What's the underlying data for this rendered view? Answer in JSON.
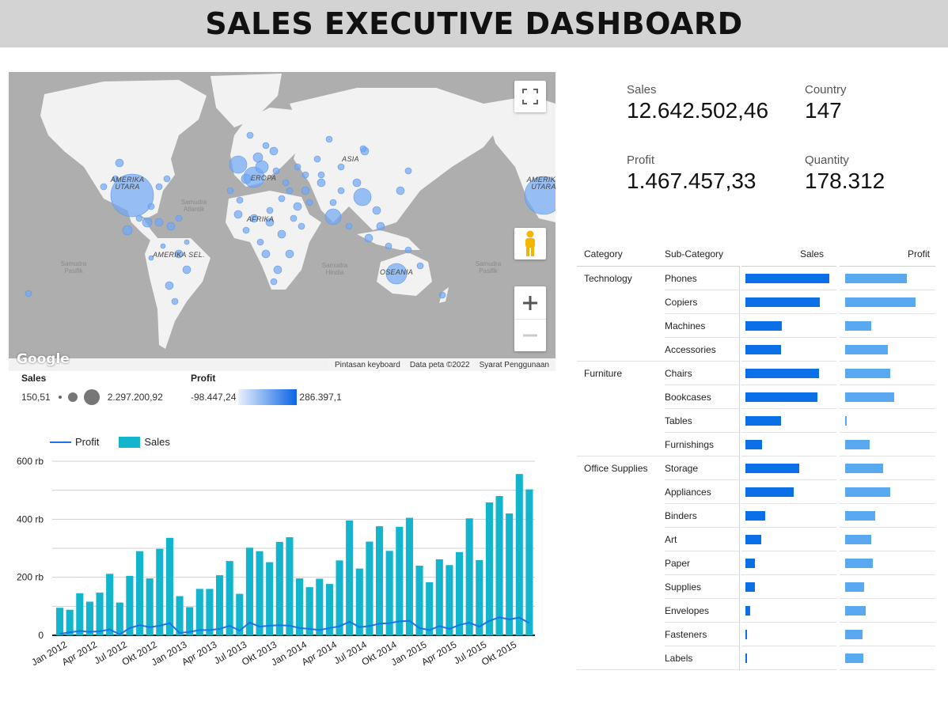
{
  "header": {
    "title": "SALES EXECUTIVE DASHBOARD"
  },
  "map": {
    "labels": {
      "north_america": "AMERIKA UTARA",
      "north_america_repeat": "AMERIKA UTARA",
      "south_america": "AMERIKA SEL.",
      "asia": "ASIA",
      "africa": "AFRIKA",
      "europe": "EROPA",
      "oceania": "OSEANIA"
    },
    "oceans": {
      "atlantic": "Samudra Atlantik",
      "pacific_left": "Samudra Pasifik",
      "indian": "Samudra Hindia",
      "pacific_right": "Samudra Pasifik"
    },
    "google_logo": "Google",
    "footer": {
      "shortcuts": "Pintasan keyboard",
      "map_data": "Data peta ©2022",
      "terms": "Syarat Penggunaan"
    },
    "bubble_color": "#6fa8f5",
    "land_color": "#f2f2f2",
    "water_color": "#aeaeae"
  },
  "legend": {
    "sales": {
      "title": "Sales",
      "min": "150,51",
      "max": "2.297.200,92"
    },
    "profit": {
      "title": "Profit",
      "min": "-98.447,24",
      "max": "286.397,1"
    }
  },
  "kpis": {
    "sales": {
      "label": "Sales",
      "value": "12.642.502,46"
    },
    "country": {
      "label": "Country",
      "value": "147"
    },
    "profit": {
      "label": "Profit",
      "value": "1.467.457,33"
    },
    "quantity": {
      "label": "Quantity",
      "value": "178.312"
    }
  },
  "table": {
    "headers": {
      "category": "Category",
      "subcategory": "Sub-Category",
      "sales": "Sales",
      "profit": "Profit"
    },
    "groups": [
      {
        "category": "Technology",
        "rows": [
          {
            "sub": "Phones",
            "sales": 1.0,
            "profit": 0.75
          },
          {
            "sub": "Copiers",
            "sales": 0.89,
            "profit": 0.86
          },
          {
            "sub": "Machines",
            "sales": 0.43,
            "profit": 0.32
          },
          {
            "sub": "Accessories",
            "sales": 0.42,
            "profit": 0.52
          }
        ]
      },
      {
        "category": "Furniture",
        "rows": [
          {
            "sub": "Chairs",
            "sales": 0.88,
            "profit": 0.55
          },
          {
            "sub": "Bookcases",
            "sales": 0.86,
            "profit": 0.6
          },
          {
            "sub": "Tables",
            "sales": 0.42,
            "profit": 0.02
          },
          {
            "sub": "Furnishings",
            "sales": 0.2,
            "profit": 0.3
          }
        ]
      },
      {
        "category": "Office Supplies",
        "rows": [
          {
            "sub": "Storage",
            "sales": 0.64,
            "profit": 0.46
          },
          {
            "sub": "Appliances",
            "sales": 0.58,
            "profit": 0.55
          },
          {
            "sub": "Binders",
            "sales": 0.24,
            "profit": 0.37
          },
          {
            "sub": "Art",
            "sales": 0.19,
            "profit": 0.32
          },
          {
            "sub": "Paper",
            "sales": 0.11,
            "profit": 0.34
          },
          {
            "sub": "Supplies",
            "sales": 0.11,
            "profit": 0.23
          },
          {
            "sub": "Envelopes",
            "sales": 0.06,
            "profit": 0.25
          },
          {
            "sub": "Fasteners",
            "sales": 0.015,
            "profit": 0.21
          },
          {
            "sub": "Labels",
            "sales": 0.015,
            "profit": 0.22
          }
        ]
      }
    ]
  },
  "chart_data": {
    "type": "bar",
    "legend": [
      "Profit",
      "Sales"
    ],
    "ylim": [
      0,
      600000
    ],
    "yticks": [
      {
        "value": 0,
        "label": "0"
      },
      {
        "value": 200000,
        "label": "200 rb"
      },
      {
        "value": 400000,
        "label": "400 rb"
      },
      {
        "value": 600000,
        "label": "600 rb"
      }
    ],
    "xtick_labels": [
      "Jan 2012",
      "Apr 2012",
      "Jul 2012",
      "Okt 2012",
      "Jan 2013",
      "Apr 2013",
      "Jul 2013",
      "Okt 2013",
      "Jan 2014",
      "Apr 2014",
      "Jul 2014",
      "Okt 2014",
      "Jan 2015",
      "Apr 2015",
      "Jul 2015",
      "Okt 2015"
    ],
    "series": [
      {
        "name": "Sales",
        "type": "bar",
        "color": "#12b5cb",
        "values": [
          95000,
          88000,
          145000,
          116000,
          147000,
          212000,
          113000,
          205000,
          290000,
          196000,
          298000,
          336000,
          135000,
          97000,
          160000,
          160000,
          207000,
          256000,
          143000,
          302000,
          290000,
          252000,
          322000,
          338000,
          196000,
          166000,
          195000,
          177000,
          258000,
          396000,
          230000,
          323000,
          376000,
          291000,
          374000,
          405000,
          240000,
          183000,
          262000,
          242000,
          287000,
          403000,
          259000,
          458000,
          480000,
          420000,
          556000,
          503000
        ]
      },
      {
        "name": "Profit",
        "type": "line",
        "color": "#1a73e8",
        "values": [
          5000,
          10000,
          15000,
          12000,
          14000,
          20000,
          3000,
          25000,
          35000,
          28000,
          33000,
          42000,
          8000,
          12000,
          18000,
          18000,
          22000,
          33000,
          16000,
          44000,
          30000,
          33000,
          35000,
          33000,
          25000,
          22000,
          18000,
          25000,
          31000,
          47000,
          28000,
          32000,
          40000,
          42000,
          48000,
          50000,
          25000,
          18000,
          32000,
          22000,
          36000,
          43000,
          30000,
          50000,
          62000,
          55000,
          61000,
          42000
        ]
      }
    ]
  }
}
